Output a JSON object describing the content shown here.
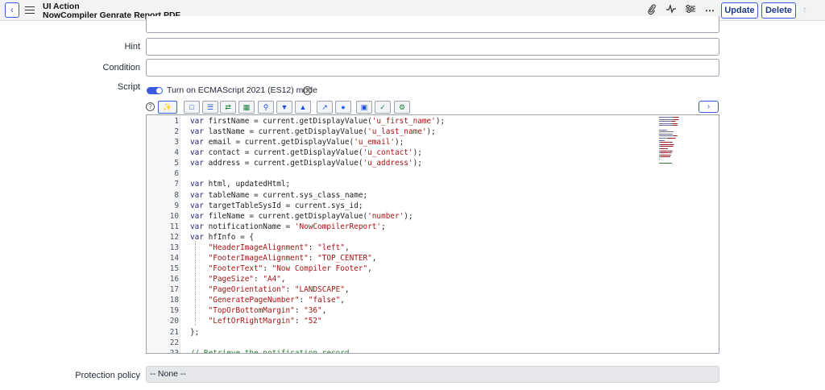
{
  "header": {
    "record_type": "UI Action",
    "record_name": "NowCompiler Genrate Report PDF",
    "buttons": {
      "update": "Update",
      "delete": "Delete"
    },
    "icons": [
      "back-arrow-icon",
      "hamburger-menu-icon",
      "paperclip-icon",
      "activity-icon",
      "sliders-icon",
      "more-icon",
      "up-arrow-icon"
    ]
  },
  "form": {
    "hint_label": "Hint",
    "hint_value": "",
    "condition_label": "Condition",
    "condition_value": "",
    "script_label": "Script",
    "es_toggle_label": "Turn on ECMAScript 2021 (ES12) mode",
    "es_toggle_on": true,
    "protection_label": "Protection policy",
    "protection_value": "-- None --"
  },
  "toolbar": {
    "icons": [
      "help-icon",
      "toggle-syntax-icon",
      "comment-icon",
      "format-icon",
      "replace-icon",
      "replace-all-icon",
      "search-icon",
      "find-next-icon",
      "find-prev-icon",
      "fullscreen-icon",
      "script-debugger-icon",
      "save-icon",
      "check-syntax-icon",
      "settings-icon",
      "expand-panel-icon"
    ]
  },
  "code": [
    {
      "n": "1",
      "parts": [
        [
          "kw",
          "var "
        ],
        [
          "plain",
          "firstName = current.getDisplayValue("
        ],
        [
          "str",
          "'u_first_name'"
        ],
        [
          "plain",
          ");"
        ]
      ]
    },
    {
      "n": "2",
      "parts": [
        [
          "kw",
          "var "
        ],
        [
          "plain",
          "lastName = current.getDisplayValue("
        ],
        [
          "str",
          "'u_last_name'"
        ],
        [
          "plain",
          ");"
        ]
      ]
    },
    {
      "n": "3",
      "parts": [
        [
          "kw",
          "var "
        ],
        [
          "plain",
          "email = current.getDisplayValue("
        ],
        [
          "str",
          "'u_email'"
        ],
        [
          "plain",
          ");"
        ]
      ]
    },
    {
      "n": "4",
      "parts": [
        [
          "kw",
          "var "
        ],
        [
          "plain",
          "contact = current.getDisplayValue("
        ],
        [
          "str",
          "'u_contact'"
        ],
        [
          "plain",
          ");"
        ]
      ]
    },
    {
      "n": "5",
      "parts": [
        [
          "kw",
          "var "
        ],
        [
          "plain",
          "address = current.getDisplayValue("
        ],
        [
          "str",
          "'u_address'"
        ],
        [
          "plain",
          ");"
        ]
      ]
    },
    {
      "n": "6",
      "parts": []
    },
    {
      "n": "7",
      "parts": [
        [
          "kw",
          "var "
        ],
        [
          "plain",
          "html, updatedHtml;"
        ]
      ]
    },
    {
      "n": "8",
      "parts": [
        [
          "kw",
          "var "
        ],
        [
          "plain",
          "tableName = current.sys_class_name;"
        ]
      ]
    },
    {
      "n": "9",
      "parts": [
        [
          "kw",
          "var "
        ],
        [
          "plain",
          "targetTableSysId = current.sys_id;"
        ]
      ]
    },
    {
      "n": "10",
      "parts": [
        [
          "kw",
          "var "
        ],
        [
          "plain",
          "fileName = current.getDisplayValue("
        ],
        [
          "str",
          "'number'"
        ],
        [
          "plain",
          ");"
        ]
      ]
    },
    {
      "n": "11",
      "parts": [
        [
          "kw",
          "var "
        ],
        [
          "plain",
          "notificationName = "
        ],
        [
          "str",
          "'NowCompilerReport'"
        ],
        [
          "plain",
          ";"
        ]
      ]
    },
    {
      "n": "12",
      "parts": [
        [
          "kw",
          "var "
        ],
        [
          "plain",
          "hfInfo = {"
        ]
      ]
    },
    {
      "n": "13",
      "parts": [
        [
          "plain",
          "    "
        ],
        [
          "str",
          "\"HeaderImageAlignment\""
        ],
        [
          "plain",
          ": "
        ],
        [
          "str",
          "\"left\""
        ],
        [
          "plain",
          ","
        ]
      ]
    },
    {
      "n": "14",
      "parts": [
        [
          "plain",
          "    "
        ],
        [
          "str",
          "\"FooterImageAlignment\""
        ],
        [
          "plain",
          ": "
        ],
        [
          "str",
          "\"TOP_CENTER\""
        ],
        [
          "plain",
          ","
        ]
      ]
    },
    {
      "n": "15",
      "parts": [
        [
          "plain",
          "    "
        ],
        [
          "str",
          "\"FooterText\""
        ],
        [
          "plain",
          ": "
        ],
        [
          "str",
          "\"Now Compiler Footer\""
        ],
        [
          "plain",
          ","
        ]
      ]
    },
    {
      "n": "16",
      "parts": [
        [
          "plain",
          "    "
        ],
        [
          "str",
          "\"PageSize\""
        ],
        [
          "plain",
          ": "
        ],
        [
          "str",
          "\"A4\""
        ],
        [
          "plain",
          ","
        ]
      ]
    },
    {
      "n": "17",
      "parts": [
        [
          "plain",
          "    "
        ],
        [
          "str",
          "\"PageOrientation\""
        ],
        [
          "plain",
          ": "
        ],
        [
          "str",
          "\"LANDSCAPE\""
        ],
        [
          "plain",
          ","
        ]
      ]
    },
    {
      "n": "18",
      "parts": [
        [
          "plain",
          "    "
        ],
        [
          "str",
          "\"GeneratePageNumber\""
        ],
        [
          "plain",
          ": "
        ],
        [
          "str",
          "\"false\""
        ],
        [
          "plain",
          ","
        ]
      ]
    },
    {
      "n": "19",
      "parts": [
        [
          "plain",
          "    "
        ],
        [
          "str",
          "\"TopOrBottomMargin\""
        ],
        [
          "plain",
          ": "
        ],
        [
          "str",
          "\"36\""
        ],
        [
          "plain",
          ","
        ]
      ]
    },
    {
      "n": "20",
      "parts": [
        [
          "plain",
          "    "
        ],
        [
          "str",
          "\"LeftOrRightMargin\""
        ],
        [
          "plain",
          ": "
        ],
        [
          "str",
          "\"52\""
        ]
      ]
    },
    {
      "n": "21",
      "parts": [
        [
          "plain",
          "};"
        ]
      ]
    },
    {
      "n": "22",
      "parts": []
    },
    {
      "n": "23",
      "parts": [
        [
          "cmt",
          "// Retrieve the notification record"
        ]
      ]
    }
  ],
  "colors": {
    "accent": "#3b5bdb",
    "string": "#a31515",
    "comment": "#2e7d32",
    "keyword": "#1e1e7a"
  }
}
